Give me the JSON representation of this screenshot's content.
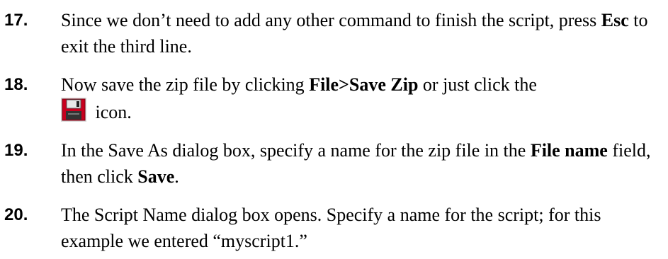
{
  "steps": [
    {
      "number": "17.",
      "text_1": "Since we don’t need to add any other command to finish the script, press ",
      "bold_1": "Esc",
      "text_2": " to exit the third line."
    },
    {
      "number": "18.",
      "text_1": "Now save the zip file by clicking ",
      "bold_1": "File>Save Zip",
      "text_2": " or just click the",
      "icon": "floppy-disk-save-icon",
      "text_3": " icon."
    },
    {
      "number": "19.",
      "text_1": "In the Save As dialog box, specify a name for the zip file in the ",
      "bold_1": "File name",
      "text_2": " field, then click ",
      "bold_2": "Save",
      "text_3": "."
    },
    {
      "number": "20.",
      "text_1": "The Script Name dialog box opens. Specify a name for the script; for this example we entered “myscript1.”"
    }
  ],
  "colors": {
    "text": "#000000",
    "icon_red": "#c8001e",
    "icon_bg": "#d8d8d8"
  }
}
